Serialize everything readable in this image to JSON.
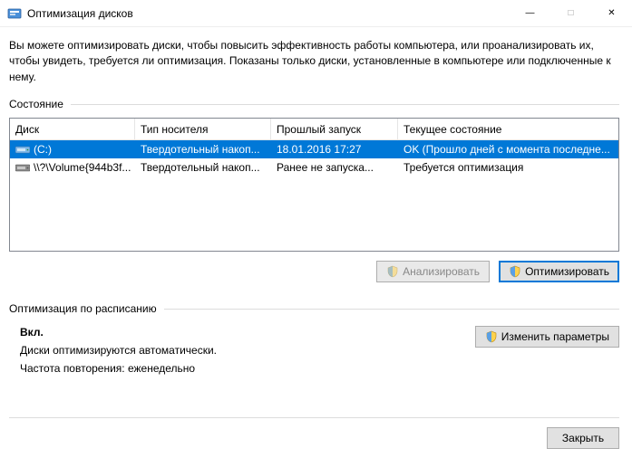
{
  "window": {
    "title": "Оптимизация дисков"
  },
  "intro": "Вы можете оптимизировать диски, чтобы повысить эффективность работы  компьютера, или проанализировать их, чтобы увидеть, требуется ли оптимизация. Показаны только диски, установленные в компьютере или подключенные к нему.",
  "section_state": "Состояние",
  "columns": {
    "c0": "Диск",
    "c1": "Тип носителя",
    "c2": "Прошлый запуск",
    "c3": "Текущее состояние"
  },
  "rows": [
    {
      "name": "(C:)",
      "media": "Твердотельный накоп...",
      "last": "18.01.2016 17:27",
      "state": "OK (Прошло дней с момента последне..."
    },
    {
      "name": "\\\\?\\Volume{944b3f...",
      "media": "Твердотельный накоп...",
      "last": "Ранее не запуска...",
      "state": "Требуется оптимизация"
    }
  ],
  "buttons": {
    "analyze": "Анализировать",
    "optimize": "Оптимизировать",
    "change": "Изменить параметры",
    "close": "Закрыть"
  },
  "section_schedule": "Оптимизация по расписанию",
  "schedule": {
    "state": "Вкл.",
    "line1": "Диски оптимизируются автоматически.",
    "line2": "Частота повторения: еженедельно"
  }
}
